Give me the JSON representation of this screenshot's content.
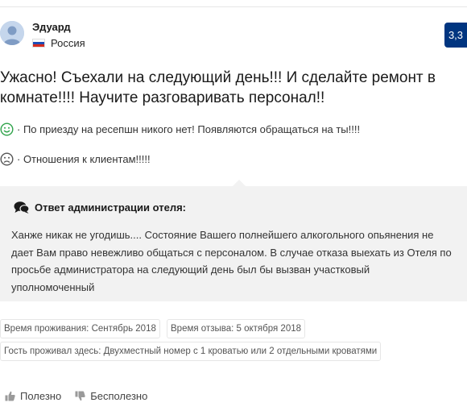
{
  "reviewer": {
    "name": "Эдуард",
    "country": "Россия",
    "avatar_icon": "user-avatar-icon",
    "flag_icon": "russia-flag-icon"
  },
  "score": "3,3",
  "review": {
    "title": "Ужасно! Съехали на следующий день!!! И сделайте ремонт в комнате!!!! Научите разговаривать персонал!!",
    "pro_text": "· По приезду на ресепшн никого нет! Появляются обращаться на ты!!!!",
    "con_text": "· Отношения к клиентам!!!!!"
  },
  "hotel_response": {
    "heading": "Ответ администрации отеля:",
    "text": "Ханже никак не угодишь.... Состояние Вашего полнейшего алкогольного опьянения не дает Вам право невежливо общаться с персоналом. В случае отказа выехать из Отеля по просьбе администратора на следующий день был бы вызван участковый уполномоченный"
  },
  "meta": {
    "stay_date": "Время проживания: Сентябрь 2018",
    "review_date": "Время отзыва: 5 октября 2018",
    "room": "Гость проживал здесь: Двухместный номер с 1 кроватью или 2 отдельными кроватями"
  },
  "votes": {
    "helpful": "Полезно",
    "not_helpful": "Бесполезно"
  },
  "colors": {
    "score_bg": "#003580",
    "positive": "#2fa34a",
    "negative": "#555555",
    "response_bg": "#f2f2f2"
  }
}
